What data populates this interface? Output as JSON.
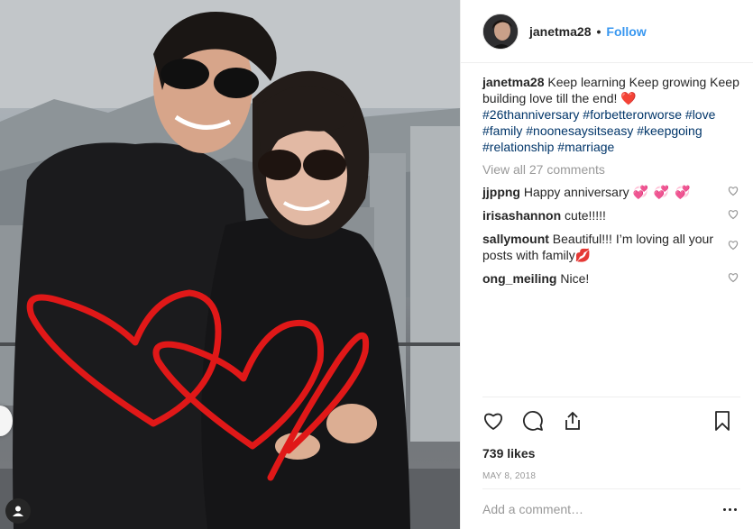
{
  "header": {
    "username": "janetma28",
    "separator": "•",
    "follow_label": "Follow"
  },
  "caption": {
    "username": "janetma28",
    "text": "Keep learning Keep growing Keep building love till the end!",
    "emoji": "❤️",
    "hashtags": [
      "#26thanniversary",
      "#forbetterorworse",
      "#love",
      "#family",
      "#noonesaysitseasy",
      "#keepgoing",
      "#relationship",
      "#marriage"
    ]
  },
  "view_all_comments": "View all 27 comments",
  "comments": [
    {
      "username": "jjppng",
      "text": "Happy anniversary",
      "emoji": "💞 💞 💞"
    },
    {
      "username": "irisashannon",
      "text": "cute!!!!!",
      "emoji": ""
    },
    {
      "username": "sallymount",
      "text": "Beautiful!!! I’m loving all your posts with family",
      "emoji": "💋"
    },
    {
      "username": "ong_meiling",
      "text": "Nice!",
      "emoji": ""
    }
  ],
  "likes": "739 likes",
  "date": "MAY 8, 2018",
  "add_comment_placeholder": "Add a comment…",
  "colors": {
    "link_blue": "#3897f0",
    "hashtag": "#003569",
    "heart_red": "#e0102b",
    "scribble_red": "#e01818"
  },
  "icons": {
    "like": "heart-outline-icon",
    "comment": "speech-bubble-icon",
    "share": "share-upload-icon",
    "save": "bookmark-icon",
    "more": "ellipsis-icon",
    "user_tag": "person-icon"
  }
}
